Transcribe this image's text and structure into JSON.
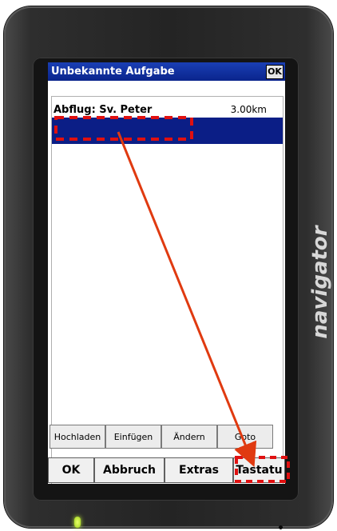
{
  "device": {
    "brand": "navigator"
  },
  "window": {
    "title": "Unbekannte Aufgabe",
    "ok_label": "OK"
  },
  "list": {
    "items": [
      {
        "name": "Abflug: Sv. Peter",
        "distance": "3.00km"
      },
      {
        "name": "",
        "distance": ""
      }
    ]
  },
  "toolbar_top": {
    "buttons": [
      "Hochladen",
      "Einfügen",
      "Ändern",
      "Goto"
    ]
  },
  "toolbar_bottom": {
    "buttons": [
      "OK",
      "Abbruch",
      "Extras",
      "Tastatu"
    ]
  },
  "annotation": {
    "arrow_color": "#e03a10",
    "highlight_color": "#e01010"
  }
}
